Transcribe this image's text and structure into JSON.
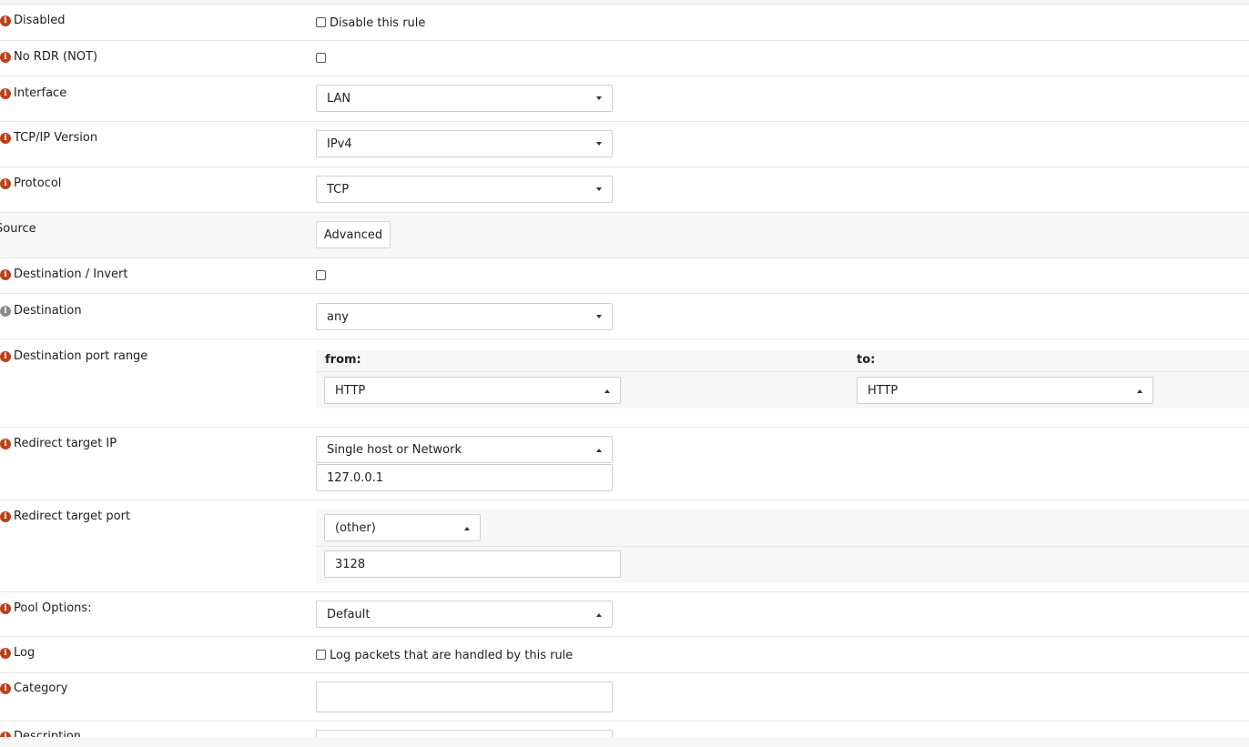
{
  "rows": {
    "disabled": {
      "label": "Disabled",
      "checkbox_label": "Disable this rule"
    },
    "nordr": {
      "label": "No RDR (NOT)"
    },
    "interface": {
      "label": "Interface",
      "value": "LAN"
    },
    "tcpip": {
      "label": "TCP/IP Version",
      "value": "IPv4"
    },
    "protocol": {
      "label": "Protocol",
      "value": "TCP"
    },
    "source": {
      "label": "Source",
      "button": "Advanced"
    },
    "dest_invert": {
      "label": "Destination / Invert"
    },
    "destination": {
      "label": "Destination",
      "value": "any"
    },
    "dest_port": {
      "label": "Destination port range",
      "from_label": "from:",
      "to_label": "to:",
      "from_value": "HTTP",
      "to_value": "HTTP"
    },
    "redirect_ip": {
      "label": "Redirect target IP",
      "type_value": "Single host or Network",
      "ip_value": "127.0.0.1"
    },
    "redirect_port": {
      "label": "Redirect target port",
      "type_value": "(other)",
      "port_value": "3128"
    },
    "pool": {
      "label": "Pool Options:",
      "value": "Default"
    },
    "log": {
      "label": "Log",
      "checkbox_label": "Log packets that are handled by this rule"
    },
    "category": {
      "label": "Category",
      "value": ""
    },
    "description": {
      "label": "Description"
    }
  },
  "icons": {
    "info": "info-icon"
  },
  "info_glyph": "i",
  "colors": {
    "info_icon": "#c03e14",
    "info_icon_neutral": "#8a8a8a"
  }
}
